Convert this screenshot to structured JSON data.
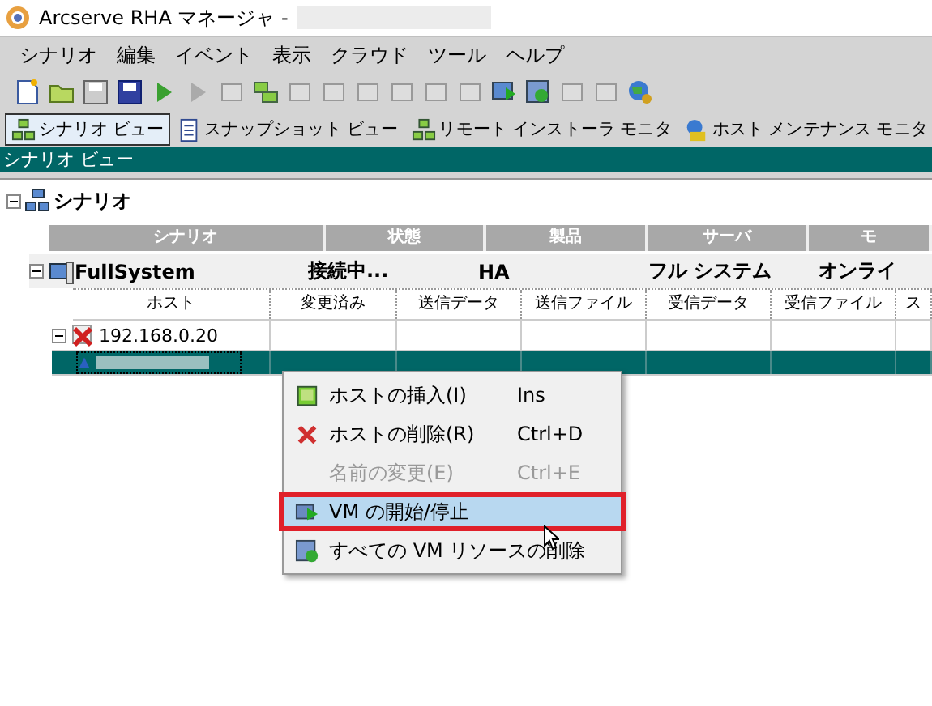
{
  "window": {
    "title": "Arcserve RHA マネージャ -"
  },
  "menu_bar": [
    "シナリオ",
    "編集",
    "イベント",
    "表示",
    "クラウド",
    "ツール",
    "ヘルプ"
  ],
  "view_tabs": [
    {
      "label": "シナリオ ビュー",
      "selected": true
    },
    {
      "label": "スナップショット ビュー",
      "selected": false
    },
    {
      "label": "リモート インストーラ モニタ",
      "selected": false
    },
    {
      "label": "ホスト メンテナンス モニタ",
      "selected": false
    }
  ],
  "panel_title": "シナリオ ビュー",
  "tree": {
    "root": "シナリオ",
    "expanded": true,
    "columns": [
      "シナリオ",
      "状態",
      "製品",
      "サーバ",
      "モ"
    ],
    "scenario": {
      "cells": [
        "FullSystem",
        "接続中...",
        "HA",
        "フル システム",
        "オンライ"
      ],
      "expanded": true,
      "host_columns": [
        "ホスト",
        "変更済み",
        "送信データ",
        "送信ファイル",
        "受信データ",
        "受信ファイル",
        "ス"
      ],
      "hosts": [
        {
          "name": "192.168.0.20",
          "expanded": true,
          "selected": false
        },
        {
          "selected": true
        }
      ]
    }
  },
  "context_menu": [
    {
      "label": "ホストの挿入(I)",
      "shortcut": "Ins",
      "disabled": false,
      "selected": false
    },
    {
      "label": "ホストの削除(R)",
      "shortcut": "Ctrl+D",
      "disabled": false,
      "selected": false
    },
    {
      "label": "名前の変更(E)",
      "shortcut": "Ctrl+E",
      "disabled": true,
      "selected": false
    },
    {
      "label": "VM の開始/停止",
      "disabled": false,
      "selected": true
    },
    {
      "label": "すべての VM リソースの削除",
      "disabled": false,
      "selected": false
    }
  ]
}
